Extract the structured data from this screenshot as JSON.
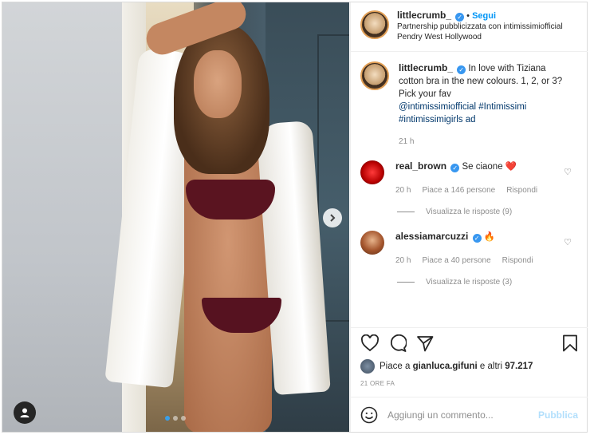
{
  "post": {
    "username": "littlecrumb_",
    "follow_separator": "•",
    "follow_label": "Segui",
    "partnership_text": "Partnership pubblicizzata con intimissimiofficial",
    "location": "Pendry West Hollywood"
  },
  "caption": {
    "username": "littlecrumb_",
    "text": "In love with Tiziana cotton bra in the new colours. 1, 2, or 3? Pick your fav",
    "tags_line1": "@intimissimiofficial #Intimissimi",
    "tags_line2": "#intimissimigirls ad",
    "time": "21 h"
  },
  "comments": [
    {
      "username": "real_brown",
      "text": "Se ciaone",
      "emoji": "❤️",
      "time": "20 h",
      "likes": "Piace a 146 persone",
      "reply_label": "Rispondi",
      "view_replies": "Visualizza le risposte (9)"
    },
    {
      "username": "alessiamarcuzzi",
      "text": "",
      "emoji": "🔥",
      "time": "20 h",
      "likes": "Piace a 40 persone",
      "reply_label": "Rispondi",
      "view_replies": "Visualizza le risposte (3)"
    }
  ],
  "likes_summary": {
    "prefix": "Piace a",
    "user": "gianluca.gifuni",
    "suffix": "e altri",
    "count": "97.217"
  },
  "posted_ago": "21 ORE FA",
  "add_comment": {
    "placeholder": "Aggiungi un commento...",
    "publish_label": "Pubblica"
  },
  "carousel": {
    "slides": 3,
    "active_index": 0
  },
  "icons": {
    "heart": "heart-icon",
    "comment": "comment-icon",
    "share": "share-icon",
    "bookmark": "bookmark-icon",
    "emoji": "emoji-icon",
    "next": "chevron-right-icon",
    "user_tag": "user-tag-icon",
    "verified": "verified-badge-icon"
  },
  "colors": {
    "accent": "#0095f6",
    "verified": "#3897f0",
    "publish_disabled": "#b2dffc",
    "secondary_text": "#8e8e8e"
  }
}
